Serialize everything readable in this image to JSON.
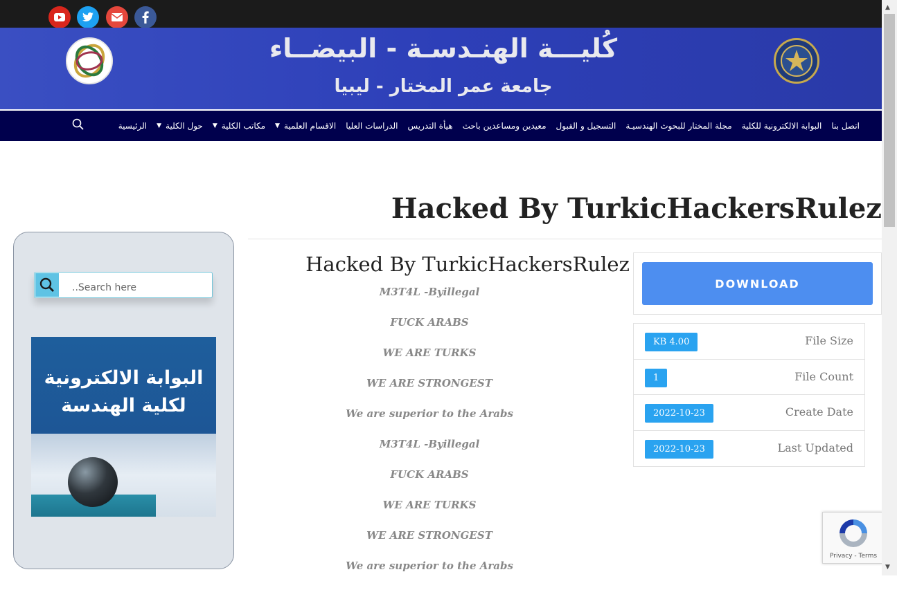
{
  "social": {
    "youtube_color": "#d9261c",
    "twitter_color": "#1da1f2",
    "email_color": "#e5473c",
    "facebook_color": "#3b5998"
  },
  "header": {
    "title_line1": "كُليـــة الهنـدسـة - البيضــاء",
    "title_line2": "جامعة عمر المختار - ليبيا",
    "bg_color": "#3444b8"
  },
  "nav": {
    "items": [
      {
        "label": "الرئيسية",
        "dropdown": false
      },
      {
        "label": "حول الكلية",
        "dropdown": true
      },
      {
        "label": "مكاتب الكلية",
        "dropdown": true
      },
      {
        "label": "الاقسام العلمية",
        "dropdown": true
      },
      {
        "label": "الدراسات العليا",
        "dropdown": false
      },
      {
        "label": "هيأة التدريس",
        "dropdown": false
      },
      {
        "label": "معيدين ومساعدين باحث",
        "dropdown": false
      },
      {
        "label": "التسجيل و القبول",
        "dropdown": false
      },
      {
        "label": "مجلة المختار للبحوث الهندسيـة",
        "dropdown": false
      },
      {
        "label": "البوابة الالكترونية للكلية",
        "dropdown": false
      },
      {
        "label": "اتصل بنا",
        "dropdown": false
      }
    ],
    "bg_color": "#00004d"
  },
  "page": {
    "title": "Hacked By TurkicHackersRulez"
  },
  "sidebar": {
    "search_placeholder": "..Search here",
    "banner_text_line1": "البوابة الالكترونية",
    "banner_text_line2": "لكلية الهندسة"
  },
  "post": {
    "title": "Hacked By TurkicHackersRulez",
    "lines": [
      "M3T4L -Byillegal",
      "FUCK ARABS",
      "WE ARE TURKS",
      "WE ARE STRONGEST",
      "We are superior to the Arabs",
      "M3T4L -Byillegal",
      "FUCK ARABS",
      "WE ARE TURKS",
      "WE ARE STRONGEST",
      "We are superior to the Arabs"
    ]
  },
  "download": {
    "button_label": "DOWNLOAD",
    "button_color": "#4d8ef0"
  },
  "file_info": [
    {
      "label": "File Size",
      "value": "KB 4.00"
    },
    {
      "label": "File Count",
      "value": "1"
    },
    {
      "label": "Create Date",
      "value": "2022-10-23"
    },
    {
      "label": "Last Updated",
      "value": "2022-10-23"
    }
  ],
  "recaptcha": {
    "text": "Privacy - Terms"
  }
}
